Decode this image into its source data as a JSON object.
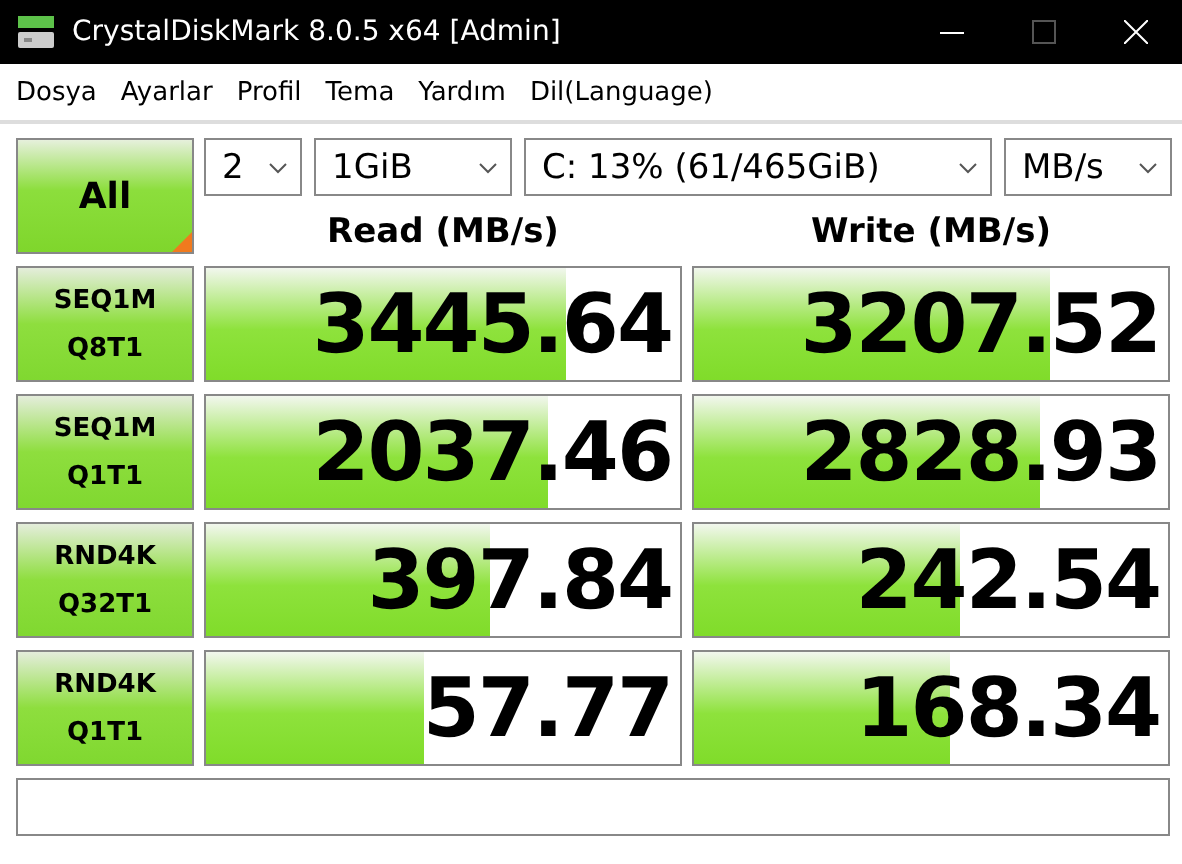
{
  "window": {
    "title": "CrystalDiskMark 8.0.5 x64 [Admin]"
  },
  "menu": [
    "Dosya",
    "Ayarlar",
    "Profil",
    "Tema",
    "Yardım",
    "Dil(Language)"
  ],
  "all_button": {
    "label": "All"
  },
  "selects": [
    {
      "value": "2"
    },
    {
      "value": "1GiB"
    },
    {
      "value": "C: 13% (61/465GiB)"
    },
    {
      "value": "MB/s"
    }
  ],
  "columns": [
    "Read (MB/s)",
    "Write (MB/s)"
  ],
  "tests": [
    {
      "line1": "SEQ1M",
      "line2": "Q8T1",
      "read": {
        "value": "3445.64",
        "level": 0.76
      },
      "write": {
        "value": "3207.52",
        "level": 0.75
      }
    },
    {
      "line1": "SEQ1M",
      "line2": "Q1T1",
      "read": {
        "value": "2037.46",
        "level": 0.72
      },
      "write": {
        "value": "2828.93",
        "level": 0.73
      }
    },
    {
      "line1": "RND4K",
      "line2": "Q32T1",
      "read": {
        "value": "397.84",
        "level": 0.6
      },
      "write": {
        "value": "242.54",
        "level": 0.56
      }
    },
    {
      "line1": "RND4K",
      "line2": "Q1T1",
      "read": {
        "value": "57.77",
        "level": 0.46
      },
      "write": {
        "value": "168.34",
        "level": 0.54
      }
    }
  ]
}
